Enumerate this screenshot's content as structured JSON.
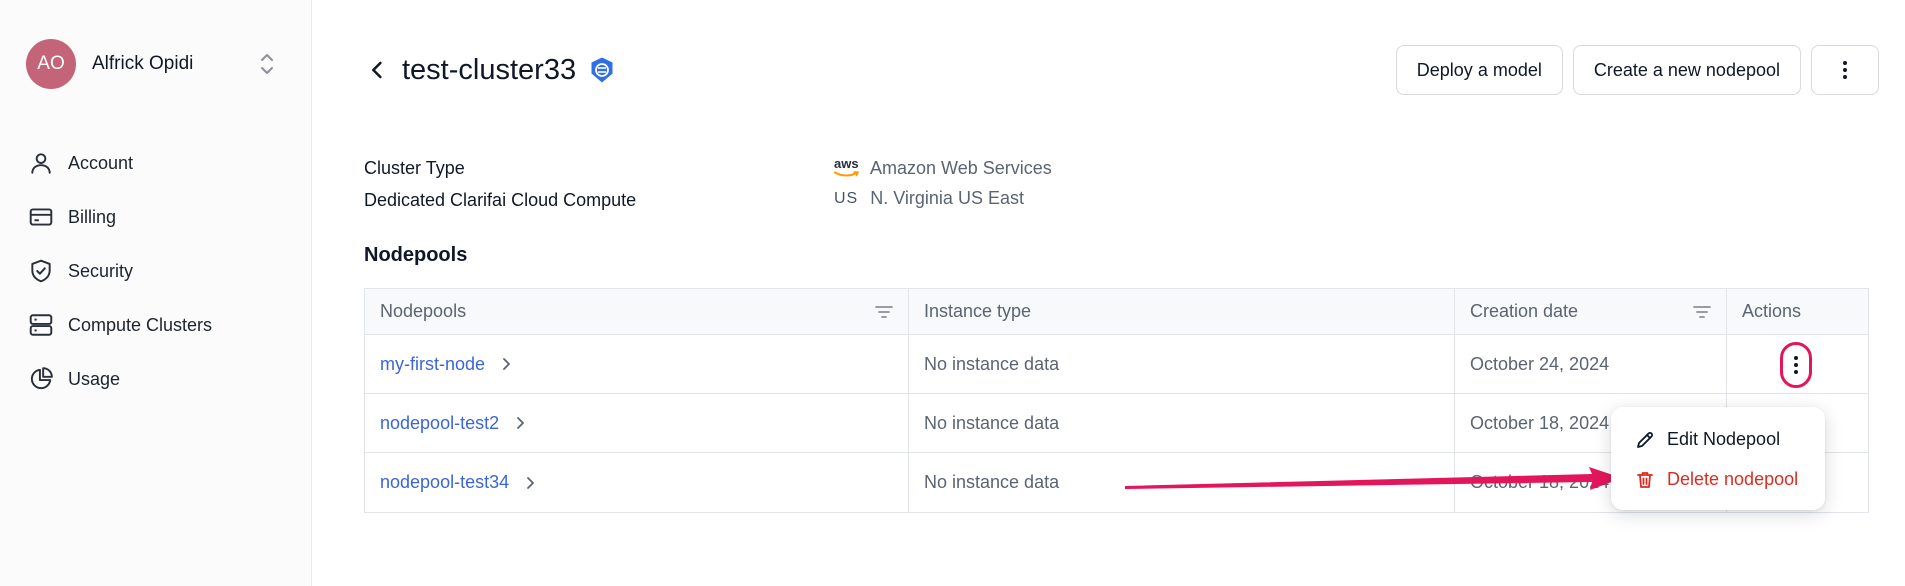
{
  "user": {
    "initials": "AO",
    "name": "Alfrick Opidi"
  },
  "sidebar": {
    "items": [
      {
        "label": "Account",
        "icon": "user-icon"
      },
      {
        "label": "Billing",
        "icon": "credit-card-icon"
      },
      {
        "label": "Security",
        "icon": "shield-check-icon"
      },
      {
        "label": "Compute Clusters",
        "icon": "server-icon"
      },
      {
        "label": "Usage",
        "icon": "pie-chart-icon"
      }
    ]
  },
  "header": {
    "title": "test-cluster33",
    "buttons": {
      "deploy": "Deploy a model",
      "create": "Create a new nodepool"
    }
  },
  "cluster_info": {
    "type_label": "Cluster Type",
    "type_value": "Dedicated Clarifai Cloud Compute",
    "provider": "Amazon Web Services",
    "provider_logo_text": "aws",
    "region_code": "US",
    "region": "N. Virginia US East"
  },
  "nodepools": {
    "title": "Nodepools",
    "columns": [
      "Nodepools",
      "Instance type",
      "Creation date",
      "Actions"
    ],
    "rows": [
      {
        "name": "my-first-node",
        "instance": "No instance data",
        "date": "October 24, 2024"
      },
      {
        "name": "nodepool-test2",
        "instance": "No instance data",
        "date": "October 18, 2024"
      },
      {
        "name": "nodepool-test34",
        "instance": "No instance data",
        "date": "October 18, 2024"
      }
    ]
  },
  "menu": {
    "edit": "Edit Nodepool",
    "delete": "Delete nodepool"
  },
  "colors": {
    "accent_link": "#3b66d6",
    "danger": "#d92d20",
    "annotation": "#e3165b",
    "avatar": "#c46478",
    "badge": "#2f6fe4"
  }
}
